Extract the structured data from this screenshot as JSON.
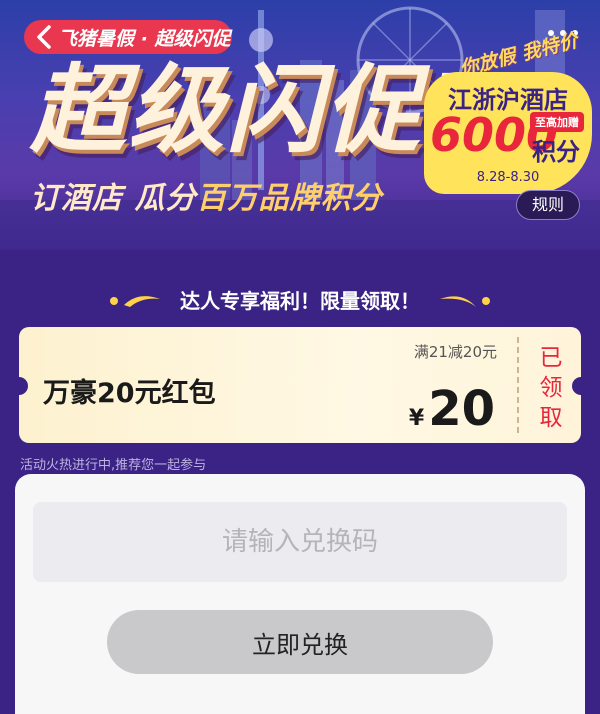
{
  "hero": {
    "back_label": "飞猪暑假 · 超级闪促",
    "title": "超级闪促!",
    "subtitle_prefix": "订酒店 瓜分",
    "subtitle_highlight": "百万品牌积分",
    "slogan": "你放假 我特价",
    "badge": {
      "title": "江浙沪酒店",
      "amount": "6000",
      "tag": "至高加赠",
      "unit": "积分",
      "dates": "8.28-8.30"
    },
    "rules_label": "规则"
  },
  "benefit": {
    "heading": "达人专享福利！限量领取！"
  },
  "coupon": {
    "name": "万豪20元红包",
    "condition": "满21减20元",
    "currency": "¥",
    "amount": "20",
    "status": "已领取"
  },
  "note": "活动火热进行中,推荐您一起参与",
  "redeem": {
    "placeholder": "请输入兑换码",
    "button_label": "立即兑换"
  },
  "colors": {
    "page_bg": "#3a2384",
    "accent_red": "#e8374f",
    "badge_yellow": "#ffe35a",
    "coupon_bg": "#fdf1cf"
  }
}
